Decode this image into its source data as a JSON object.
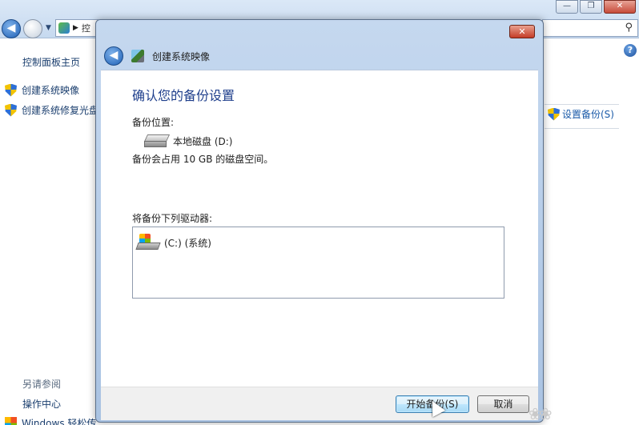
{
  "background_window": {
    "address_text": "控",
    "buttons": {
      "minimize": "—",
      "maximize": "❐",
      "close": "✕"
    }
  },
  "sidebar": {
    "home": "控制面板主页",
    "items": [
      {
        "label": "创建系统映像",
        "icon": "shield-icon"
      },
      {
        "label": "创建系统修复光盘",
        "icon": "shield-icon"
      }
    ],
    "see_also": "另请参阅",
    "action_center": "操作中心",
    "windows": "Windows 轻松传"
  },
  "right_panel": {
    "setup_backup": "设置备份(S)"
  },
  "dialog": {
    "title": "创建系统映像",
    "close": "✕",
    "heading": "确认您的备份设置",
    "location_label": "备份位置:",
    "location_drive": "本地磁盘 (D:)",
    "usage_text": "备份会占用 10 GB 的磁盘空间。",
    "drives_label": "将备份下列驱动器:",
    "drives": [
      {
        "label": "(C:) (系统)"
      }
    ],
    "buttons": {
      "start": "开始备份(S)",
      "cancel": "取消"
    }
  },
  "colors": {
    "heading": "#1f3f8c",
    "link": "#1a5aa8",
    "dialog_frame": "#aac3e2"
  }
}
